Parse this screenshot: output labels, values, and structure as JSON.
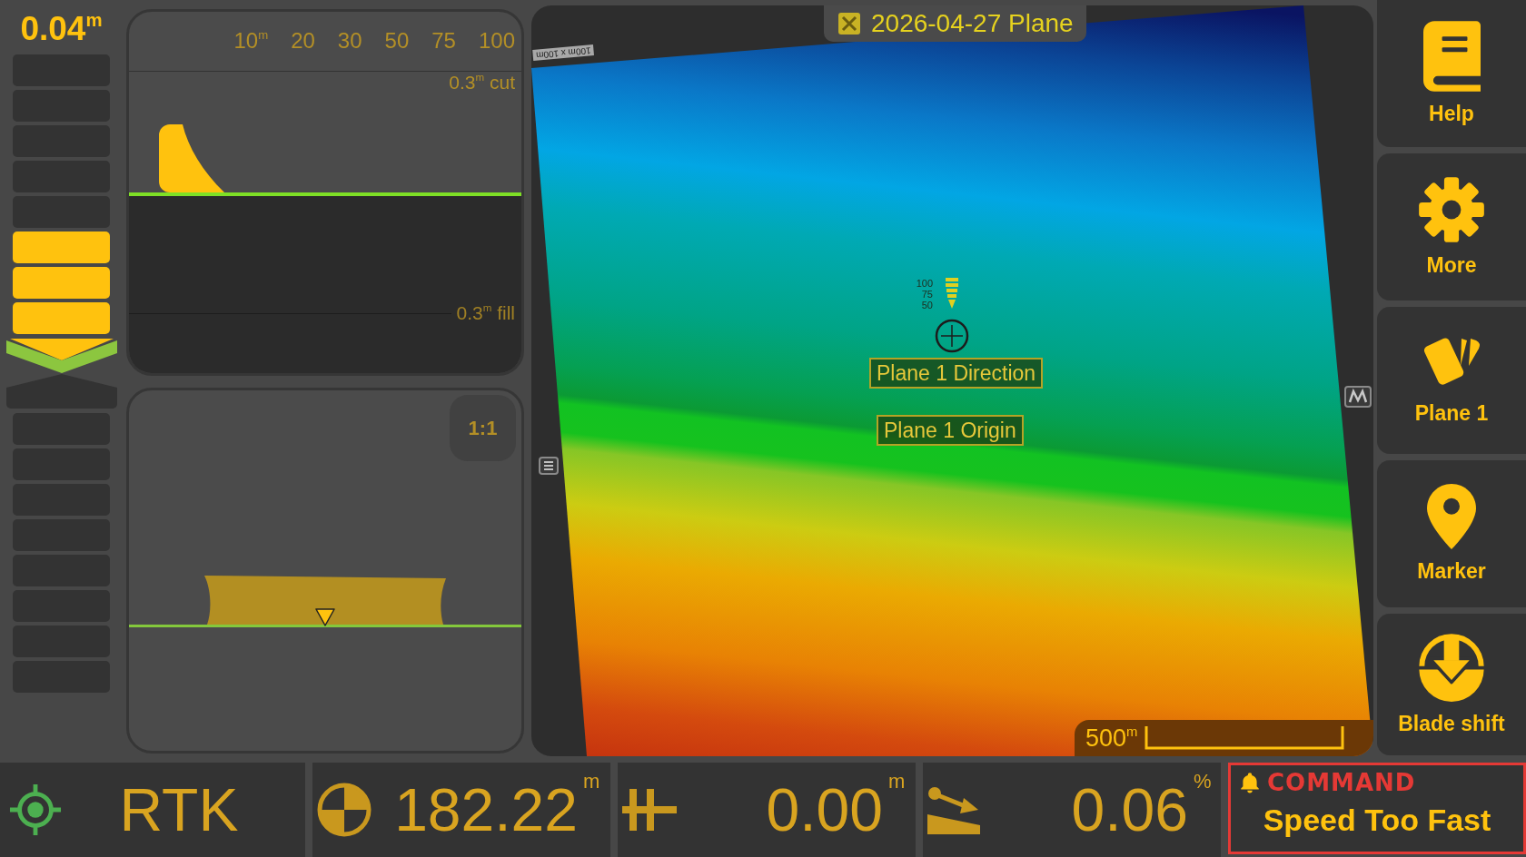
{
  "grade_indicator": {
    "reading": "0.04$^{m}$",
    "upper_segments": [
      {
        "lit": false
      },
      {
        "lit": false
      },
      {
        "lit": false
      },
      {
        "lit": false
      },
      {
        "lit": false
      },
      {
        "lit": true
      },
      {
        "lit": true
      },
      {
        "lit": true
      }
    ],
    "down_chevron": {
      "lit": true
    },
    "up_chevron": {
      "lit": false
    },
    "lower_segments": [
      {
        "lit": false
      },
      {
        "lit": false
      },
      {
        "lit": false
      },
      {
        "lit": false
      },
      {
        "lit": false
      },
      {
        "lit": false
      },
      {
        "lit": false
      },
      {
        "lit": false
      }
    ]
  },
  "profile_view": {
    "distance_labels": [
      "10$^{m}$",
      "20",
      "30",
      "50",
      "75",
      "100"
    ],
    "cut_label": "0.3$^{m}$ cut",
    "fill_label": "0.3$^{m}$ fill"
  },
  "cross_section_view": {
    "scale_button": "1:1"
  },
  "map": {
    "title": "2026-04-27 Plane",
    "grid_label": "100m x 100m",
    "ring_labels": [
      "100",
      "75",
      "50"
    ],
    "labels": [
      "Plane 1 Direction",
      "Plane 1 Origin"
    ],
    "scale_label": "500$^{m}$"
  },
  "side_buttons": [
    {
      "kind": "help",
      "label": "Help"
    },
    {
      "kind": "more",
      "label": "More"
    },
    {
      "kind": "plane",
      "label": "Plane 1"
    },
    {
      "kind": "marker",
      "label": "Marker"
    },
    {
      "kind": "blade_shift",
      "label": "Blade shift"
    }
  ],
  "status_bar": [
    {
      "kind": "gnss",
      "value": "RTK"
    },
    {
      "kind": "elevation",
      "value": "182.22",
      "unit": "m"
    },
    {
      "kind": "offset",
      "value": "0.00",
      "unit": "m"
    },
    {
      "kind": "slope",
      "value": "0.06",
      "unit": "%"
    }
  ],
  "alert": {
    "source": "COMMAND",
    "message": "Speed Too Fast"
  }
}
